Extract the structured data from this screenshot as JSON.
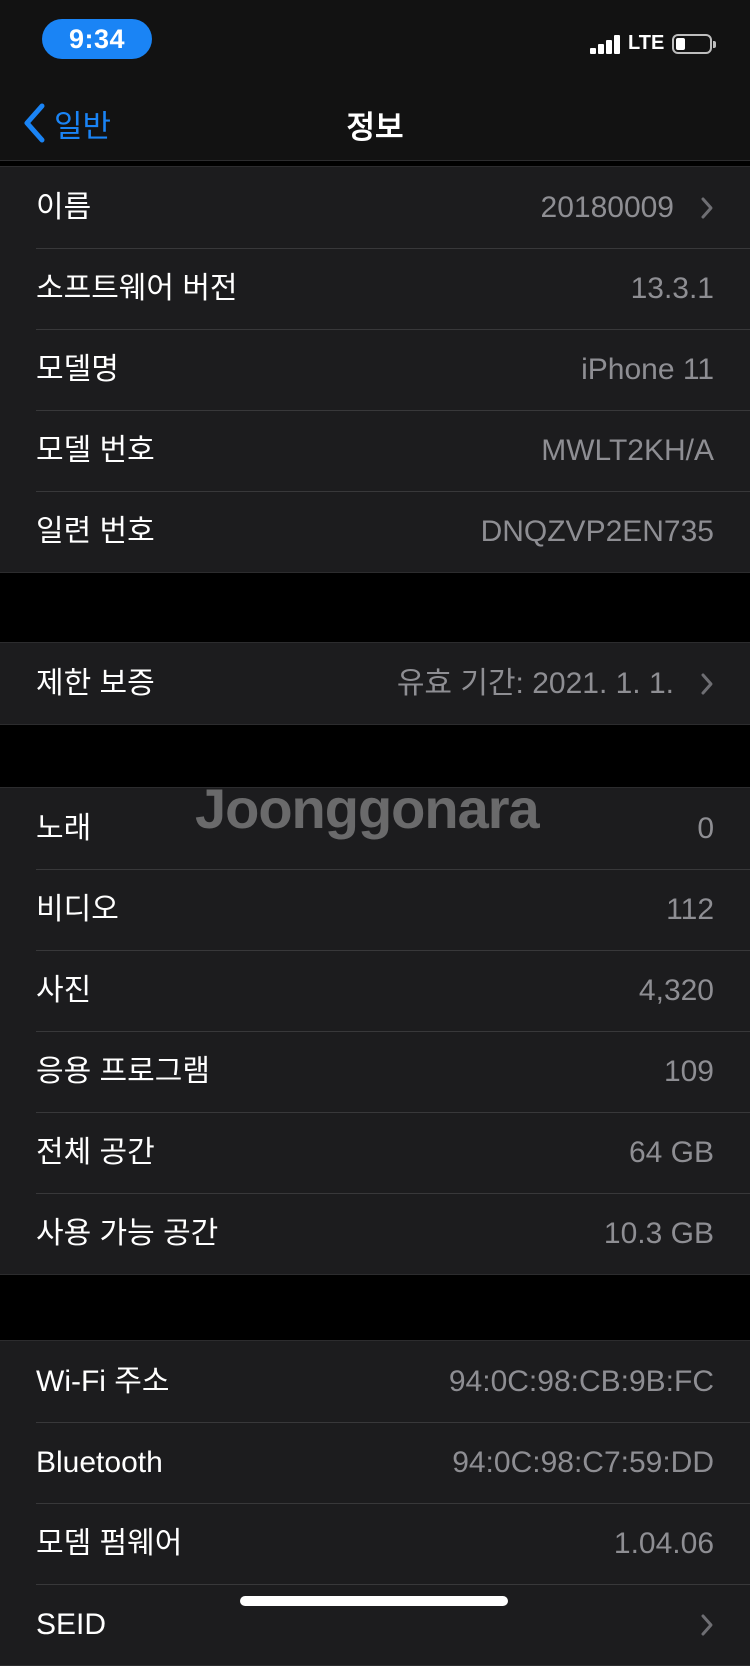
{
  "status_bar": {
    "time": "9:34",
    "network": "LTE"
  },
  "nav": {
    "back_label": "일반",
    "title": "정보"
  },
  "groups": {
    "device": [
      {
        "label": "이름",
        "value": "20180009"
      },
      {
        "label": "소프트웨어 버전",
        "value": "13.3.1"
      },
      {
        "label": "모델명",
        "value": "iPhone 11"
      },
      {
        "label": "모델 번호",
        "value": "MWLT2KH/A"
      },
      {
        "label": "일련 번호",
        "value": "DNQZVP2EN735"
      }
    ],
    "warranty": [
      {
        "label": "제한 보증",
        "value": "유효 기간: 2021. 1. 1."
      }
    ],
    "media": [
      {
        "label": "노래",
        "value": "0"
      },
      {
        "label": "비디오",
        "value": "112"
      },
      {
        "label": "사진",
        "value": "4,320"
      },
      {
        "label": "응용 프로그램",
        "value": "109"
      },
      {
        "label": "전체 공간",
        "value": "64 GB"
      },
      {
        "label": "사용 가능 공간",
        "value": "10.3 GB"
      }
    ],
    "network": [
      {
        "label": "Wi-Fi 주소",
        "value": "94:0C:98:CB:9B:FC"
      },
      {
        "label": "Bluetooth",
        "value": "94:0C:98:C7:59:DD"
      },
      {
        "label": "모뎀 펌웨어",
        "value": "1.04.06"
      },
      {
        "label": "SEID",
        "value": ""
      }
    ]
  },
  "watermark": "Joonggonara",
  "colors": {
    "accent": "#1a84f5",
    "background": "#000000",
    "cell": "#1c1c1e",
    "secondary_text": "#8e8e93"
  }
}
